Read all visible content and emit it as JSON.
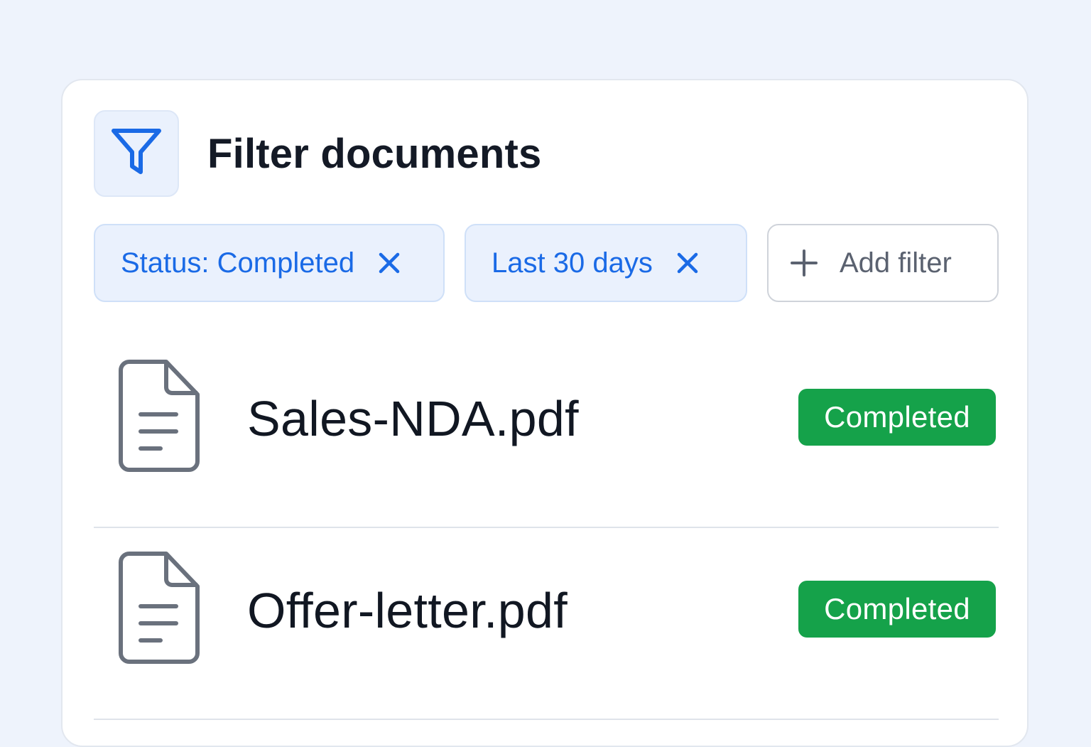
{
  "header": {
    "title": "Filter documents",
    "icon": "filter-icon",
    "accent_color": "#1a6ae6"
  },
  "filters": {
    "active": [
      {
        "label": "Status: Completed",
        "remove_icon": "close-icon"
      },
      {
        "label": "Last 30 days",
        "remove_icon": "close-icon"
      }
    ],
    "add_label": "Add filter",
    "add_icon": "plus-icon"
  },
  "documents": [
    {
      "name": "Sales-NDA.pdf",
      "status": "Completed",
      "icon": "file-document-icon"
    },
    {
      "name": "Offer-letter.pdf",
      "status": "Completed",
      "icon": "file-document-icon"
    }
  ],
  "colors": {
    "background": "#eef3fc",
    "status_completed": "#15a24a",
    "chip_bg": "#eaf1fd"
  }
}
